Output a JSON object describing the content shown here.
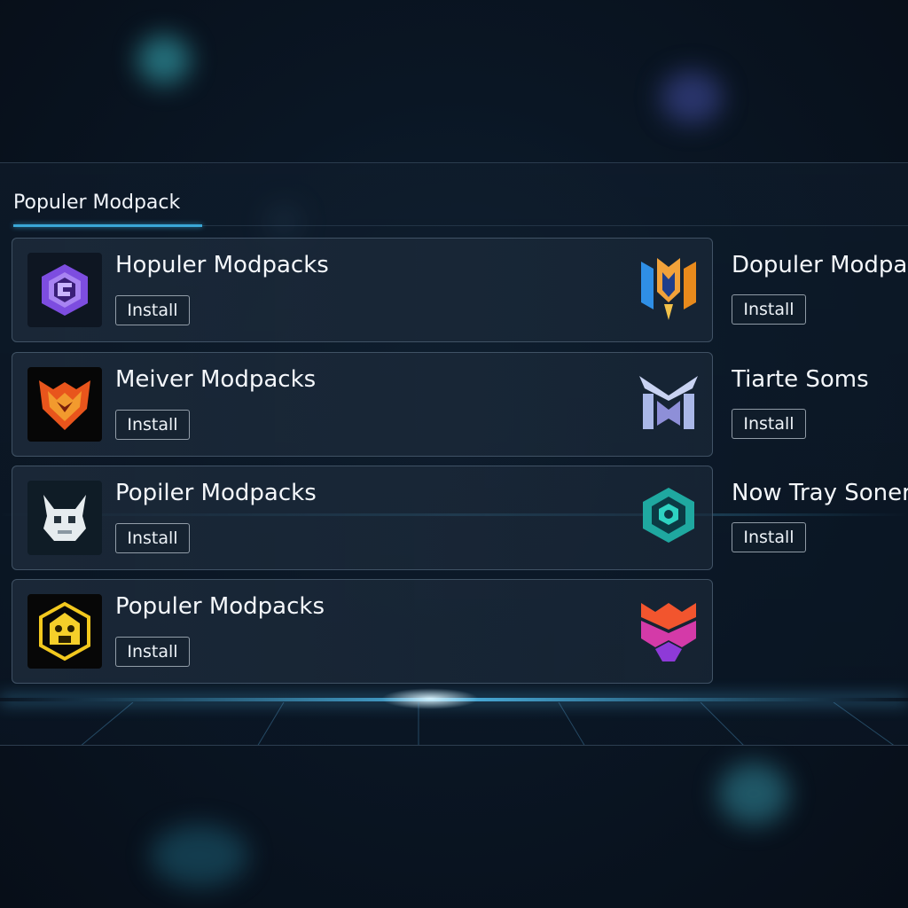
{
  "section": {
    "title": "Populer Modpack"
  },
  "cards": [
    {
      "title": "Hopuler Modpacks",
      "install_label": "Install",
      "icon": "purple-hexagon-logo-icon",
      "right_icon": "blue-orange-crown-icon"
    },
    {
      "title": "Meiver Modpacks",
      "install_label": "Install",
      "icon": "orange-fox-logo-icon",
      "right_icon": "lavender-helmet-icon"
    },
    {
      "title": "Popiler Modpacks",
      "install_label": "Install",
      "icon": "white-pixel-creature-icon",
      "right_icon": "teal-octagon-icon"
    },
    {
      "title": "Populer Modpacks",
      "install_label": "Install",
      "icon": "yellow-hexagon-logo-icon",
      "right_icon": "magenta-orange-crest-icon"
    }
  ],
  "side_items": [
    {
      "title": "Dopuler Modpacks",
      "install_label": "Install"
    },
    {
      "title": "Tiarte Soms",
      "install_label": "Install"
    },
    {
      "title": "Now Tray Soners",
      "install_label": "Install"
    }
  ],
  "colors": {
    "accent": "#3aa7d6",
    "background": "#0a1624",
    "card": "#1e2c3c"
  }
}
